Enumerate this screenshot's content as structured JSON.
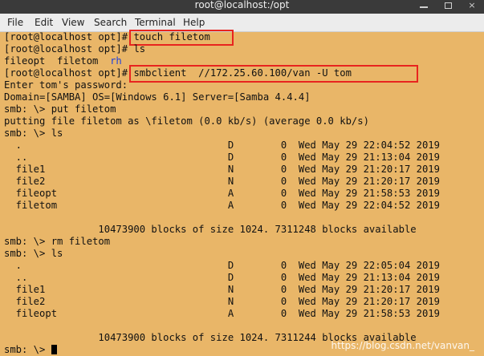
{
  "window": {
    "title": "root@localhost:/opt",
    "close_glyph": "×"
  },
  "menu": [
    "File",
    "Edit",
    "View",
    "Search",
    "Terminal",
    "Help"
  ],
  "terminal_lines": [
    {
      "prompt": "[root@localhost opt]# ",
      "command": "touch filetom"
    },
    {
      "prompt": "[root@localhost opt]# ",
      "command": "ls"
    },
    {
      "segments": [
        {
          "text": "fileopt  filetom  ",
          "color": "default"
        },
        {
          "text": "rh",
          "color": "#1a3fe0"
        }
      ]
    },
    {
      "prompt": "[root@localhost opt]# ",
      "command": "smbclient  //172.25.60.100/van -U tom"
    },
    {
      "text": "Enter tom's password:"
    },
    {
      "text": "Domain=[SAMBA] OS=[Windows 6.1] Server=[Samba 4.4.4]"
    },
    {
      "text": "smb: \\> put filetom"
    },
    {
      "text": "putting file filetom as \\filetom (0.0 kb/s) (average 0.0 kb/s)"
    },
    {
      "text": "smb: \\> ls"
    },
    {
      "text": "  .                                   D        0  Wed May 29 22:04:52 2019"
    },
    {
      "text": "  ..                                  D        0  Wed May 29 21:13:04 2019"
    },
    {
      "text": "  file1                               N        0  Wed May 29 21:20:17 2019"
    },
    {
      "text": "  file2                               N        0  Wed May 29 21:20:17 2019"
    },
    {
      "text": "  fileopt                             A        0  Wed May 29 21:58:53 2019"
    },
    {
      "text": "  filetom                             A        0  Wed May 29 22:04:52 2019"
    },
    {
      "text": ""
    },
    {
      "text": "                10473900 blocks of size 1024. 7311248 blocks available"
    },
    {
      "text": "smb: \\> rm filetom"
    },
    {
      "text": "smb: \\> ls"
    },
    {
      "text": "  .                                   D        0  Wed May 29 22:05:04 2019"
    },
    {
      "text": "  ..                                  D        0  Wed May 29 21:13:04 2019"
    },
    {
      "text": "  file1                               N        0  Wed May 29 21:20:17 2019"
    },
    {
      "text": "  file2                               N        0  Wed May 29 21:20:17 2019"
    },
    {
      "text": "  fileopt                             A        0  Wed May 29 21:58:53 2019"
    },
    {
      "text": ""
    },
    {
      "text": "                10473900 blocks of size 1024. 7311244 blocks available"
    },
    {
      "text": "smb: \\> ",
      "cursor": true
    }
  ],
  "watermark": "https://blog.csdn.net/vanvan_",
  "colors": {
    "background": "#e9b668",
    "text": "#111111",
    "directory": "#1a3fe0",
    "highlight_box": "#e8241f",
    "titlebar": "#3a3a3a",
    "menubar": "#ececec"
  }
}
